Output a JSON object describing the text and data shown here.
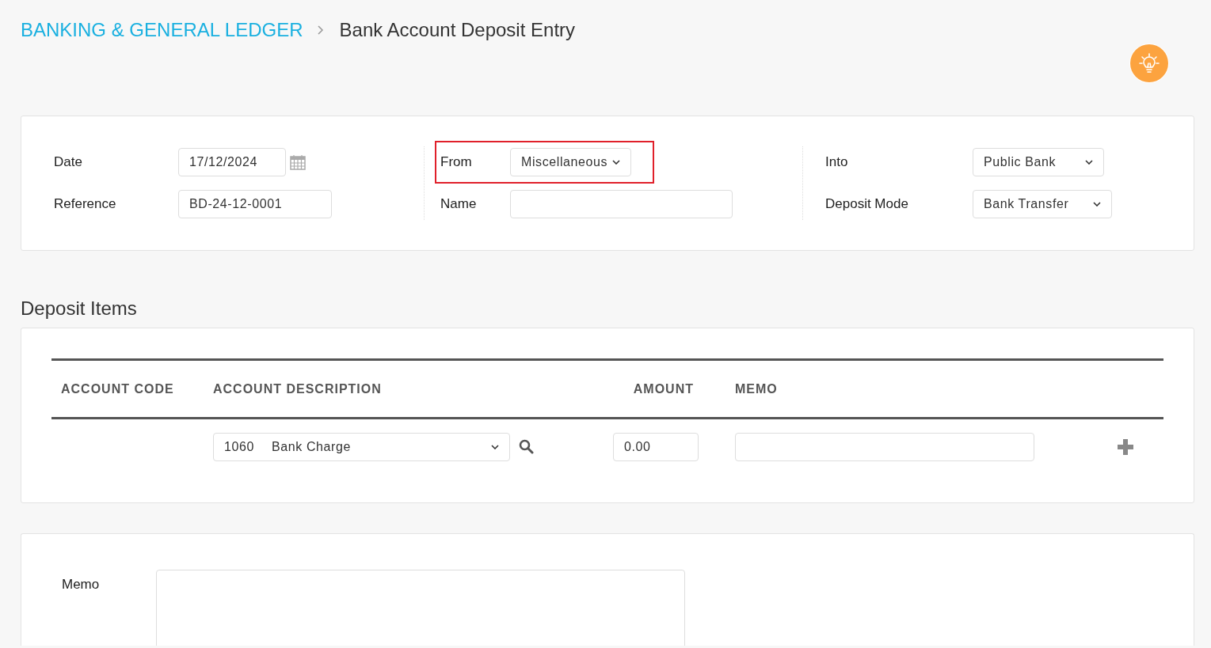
{
  "breadcrumb": {
    "parent": "BANKING & GENERAL LEDGER",
    "current": "Bank Account Deposit Entry"
  },
  "header_form": {
    "columns": [
      {
        "fields": [
          {
            "kind": "date",
            "label": "Date",
            "value": "17/12/2024",
            "highlighted": false
          },
          {
            "kind": "text",
            "label": "Reference",
            "value": "BD-24-12-0001",
            "highlighted": false
          }
        ]
      },
      {
        "fields": [
          {
            "kind": "select",
            "label": "From",
            "value": "Miscellaneous",
            "highlighted": true
          },
          {
            "kind": "text",
            "label": "Name",
            "highlighted": false
          }
        ]
      },
      {
        "fields": [
          {
            "kind": "select",
            "label": "Into",
            "value": "Public Bank",
            "highlighted": false
          },
          {
            "kind": "select",
            "label": "Deposit Mode",
            "value": "Bank Transfer",
            "highlighted": false
          }
        ]
      }
    ]
  },
  "deposit_items": {
    "title": "Deposit Items",
    "columns": [
      "ACCOUNT CODE",
      "ACCOUNT DESCRIPTION",
      "AMOUNT",
      "MEMO"
    ],
    "rows": [
      {
        "account_code": "1060",
        "account_description": "Bank Charge",
        "amount": "0.00"
      }
    ]
  },
  "memo_section": {
    "label": "Memo"
  }
}
